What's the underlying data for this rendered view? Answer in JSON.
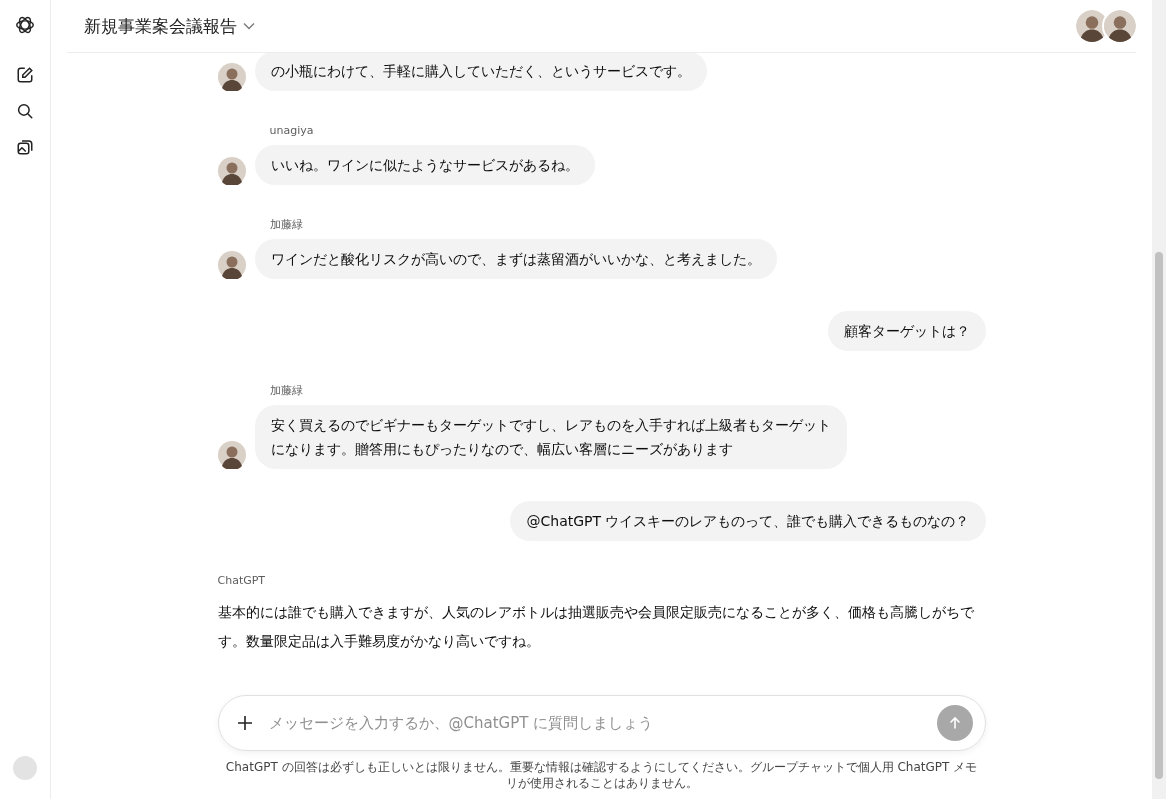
{
  "header": {
    "title": "新規事業案会議報告"
  },
  "messages": [
    {
      "kind": "other",
      "text": "の小瓶にわけて、手軽に購入していただく、というサービスです。"
    },
    {
      "kind": "other",
      "name": "unagiya",
      "text": "いいね。ワインに似たようなサービスがあるね。"
    },
    {
      "kind": "other",
      "name": "加藤緑",
      "text": "ワインだと酸化リスクが高いので、まずは蒸留酒がいいかな、と考えました。"
    },
    {
      "kind": "self",
      "text": "顧客ターゲットは？"
    },
    {
      "kind": "other",
      "name": "加藤緑",
      "text": "安く買えるのでビギナーもターゲットですし、レアものを入手すれば上級者もターゲットになります。贈答用にもぴったりなので、幅広い客層にニーズがあります"
    },
    {
      "kind": "self",
      "text": "@ChatGPT ウイスキーのレアものって、誰でも購入できるものなの？"
    },
    {
      "kind": "assistant",
      "name": "ChatGPT",
      "text": "基本的には誰でも購入できますが、人気のレアボトルは抽選販売や会員限定販売になることが多く、価格も高騰しがちです。数量限定品は入手難易度がかなり高いですね。"
    }
  ],
  "composer": {
    "placeholder": "メッセージを入力するか、@ChatGPT に質問しましょう",
    "send_disabled": true
  },
  "disclaimer": "ChatGPT の回答は必ずしも正しいとは限りません。重要な情報は確認するようにしてください。グループチャットで個人用 ChatGPT メモリが使用されることはありません。"
}
